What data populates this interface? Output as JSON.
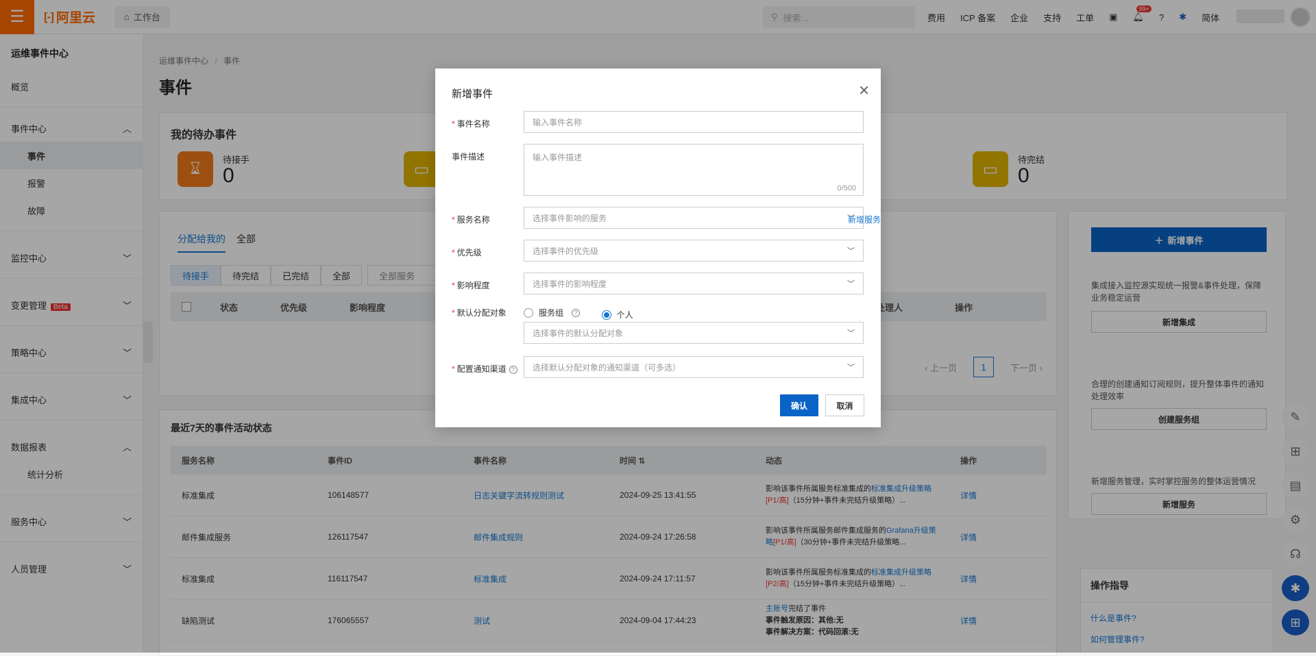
{
  "topbar": {
    "logo_text": "阿里云",
    "logo_mark": "[-]",
    "workbench": "工作台",
    "search_placeholder": "搜索...",
    "links": [
      "费用",
      "ICP 备案",
      "企业",
      "支持",
      "工单"
    ],
    "notif_badge": "99+",
    "lang": "简体"
  },
  "sidebar": {
    "title": "运维事件中心",
    "overview": "概览",
    "event_center": "事件中心",
    "sub_events": "事件",
    "sub_alerts": "报警",
    "sub_faults": "故障",
    "monitor_center": "监控中心",
    "change_mgmt": "变更管理",
    "beta": "Beta",
    "policy_center": "策略中心",
    "integration_center": "集成中心",
    "data_report": "数据报表",
    "sub_stats": "统计分析",
    "service_center": "服务中心",
    "people_mgmt": "人员管理"
  },
  "main": {
    "crumb1": "运维事件中心",
    "crumb_sep": "/",
    "crumb2": "事件",
    "title": "事件",
    "todo_title": "我的待办事件",
    "stat1_label": "待接手",
    "stat1_val": "0",
    "stat2_label": "待完结",
    "stat2_val": "0",
    "tab_assigned": "分配给我的",
    "tab_all": "全部",
    "filters": [
      "待接手",
      "待完结",
      "已完结",
      "全部"
    ],
    "filter_service": "全部服务",
    "cols": [
      "状态",
      "优先级",
      "影响程度",
      "当前处理人",
      "操作"
    ],
    "prev": "上一页",
    "page": "1",
    "next": "下一页"
  },
  "activity": {
    "title": "最近7天的事件活动状态",
    "headers": [
      "服务名称",
      "事件ID",
      "事件名称",
      "时间",
      "动态",
      "操作"
    ],
    "rows": [
      {
        "svc": "标准集成",
        "id": "106148577",
        "name": "日志关键字流转规则测试",
        "time": "2024-09-25 13:41:55",
        "d1": "影响该事件所属服务标准集成的",
        "dl": "标准集成升级策略",
        "dp": "[P1/高]",
        "d2": "（15分钟+事件未完结升级策略）...",
        "op": "详情"
      },
      {
        "svc": "邮件集成服务",
        "id": "126117547",
        "name": "邮件集成规则",
        "time": "2024-09-24 17:26:58",
        "d1": "影响该事件所属服务邮件集成服务的",
        "dl": "Grafana升级策略",
        "dp": "[P1/高]",
        "d2": "（30分钟+事件未完结升级策略...",
        "op": "详情"
      },
      {
        "svc": "标准集成",
        "id": "116117547",
        "name": "标准集成",
        "time": "2024-09-24 17:11:57",
        "d1": "影响该事件所属服务标准集成的",
        "dl": "标准集成升级策略",
        "dp": "[P2/高]",
        "d2": "（15分钟+事件未完结升级策略）...",
        "op": "详情"
      },
      {
        "svc": "缺陷测试",
        "id": "176065557",
        "name": "测试",
        "time": "2024-09-04 17:44:23",
        "d1": "主账号",
        "dl": "完结了事件",
        "dp": "事件触发原因：其他:无",
        "d2": "事件解决方案：代码回滚:无",
        "op": "详情"
      }
    ]
  },
  "right": {
    "new_event": "新增事件",
    "text1": "集成接入监控源实现统一报警&事件处理，保障业务稳定运营",
    "btn1": "新增集成",
    "text2": "合理的创建通知订阅规则，提升整体事件的通知处理效率",
    "btn2": "创建服务组",
    "text3": "新增服务管理，实时掌控服务的整体运营情况",
    "btn3": "新增服务",
    "guide_title": "操作指导",
    "guide1": "什么是事件?",
    "guide2": "如何管理事件?"
  },
  "modal": {
    "title": "新增事件",
    "name_label": "事件名称",
    "name_ph": "输入事件名称",
    "desc_label": "事件描述",
    "desc_ph": "输入事件描述",
    "desc_count": "0/500",
    "svc_label": "服务名称",
    "svc_ph": "选择事件影响的服务",
    "add_svc": "新增服务",
    "pri_label": "优先级",
    "pri_ph": "选择事件的优先级",
    "impact_label": "影响程度",
    "impact_ph": "选择事件的影响程度",
    "assign_label": "默认分配对象",
    "opt_group": "服务组",
    "opt_person": "个人",
    "assign_ph": "选择事件的默认分配对象",
    "notify_label": "配置通知渠道",
    "notify_ph": "选择默认分配对象的通知渠道（可多选）",
    "ok": "确认",
    "cancel": "取消"
  }
}
